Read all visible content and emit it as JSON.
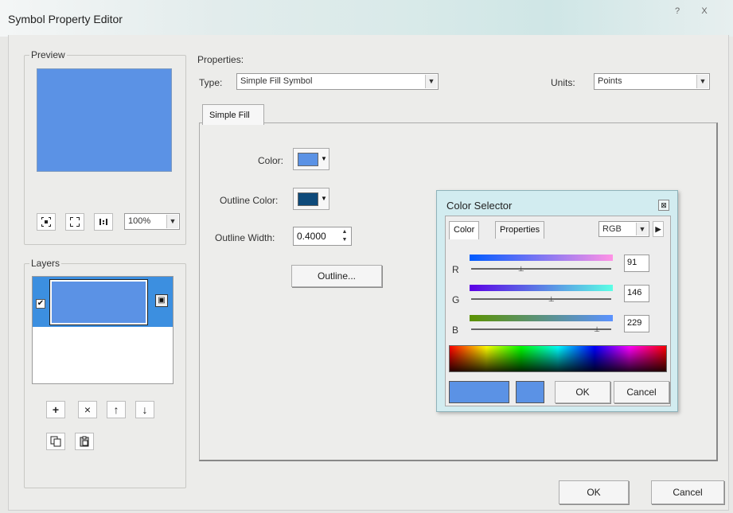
{
  "window": {
    "title": "Symbol Property Editor",
    "help_glyph": "?",
    "close_glyph": "X"
  },
  "preview": {
    "label": "Preview",
    "fill_color": "#5b92e5",
    "zoom": "100%",
    "toolbar_icons": [
      "fit-icon",
      "expand-icon",
      "actual-size-icon"
    ]
  },
  "layers": {
    "label": "Layers",
    "layer_fill_color": "#5b92e5",
    "toolbar": {
      "add": "+",
      "remove": "×",
      "move_up": "↑",
      "move_down": "↓"
    }
  },
  "properties": {
    "label": "Properties:",
    "type_label": "Type:",
    "type_value": "Simple Fill Symbol",
    "units_label": "Units:",
    "units_value": "Points",
    "tab": "Simple Fill",
    "color_label": "Color:",
    "color_value": "#5b92e5",
    "outline_color_label": "Outline Color:",
    "outline_color_value": "#0e4a7a",
    "outline_width_label": "Outline Width:",
    "outline_width_value": "0.4000",
    "outline_button": "Outline..."
  },
  "color_selector": {
    "title": "Color Selector",
    "tabs": [
      "Color",
      "Properties"
    ],
    "mode": "RGB",
    "channels": [
      {
        "name": "R",
        "value": "91",
        "fraction": 0.357
      },
      {
        "name": "G",
        "value": "146",
        "fraction": 0.573
      },
      {
        "name": "B",
        "value": "229",
        "fraction": 0.898
      }
    ],
    "current_color": "#5b92e5",
    "ok_label": "OK",
    "cancel_label": "Cancel"
  },
  "footer": {
    "ok_label": "OK",
    "cancel_label": "Cancel"
  }
}
